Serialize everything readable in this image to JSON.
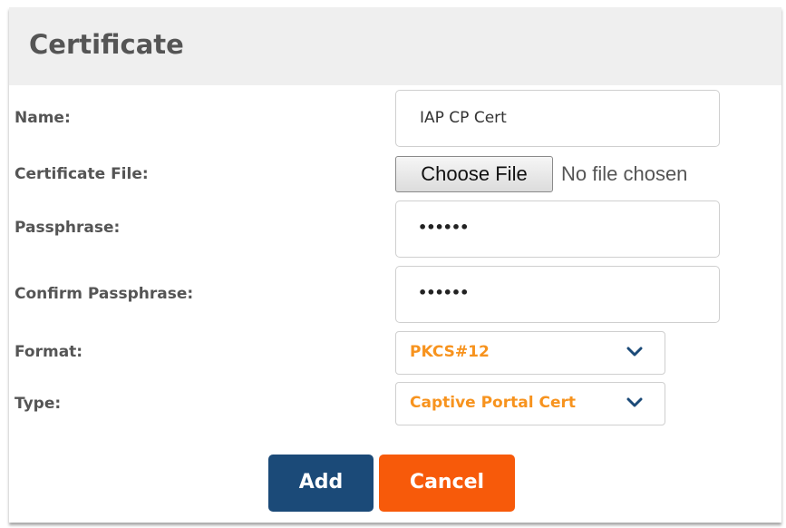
{
  "dialog": {
    "title": "Certificate"
  },
  "form": {
    "name_label": "Name:",
    "name_value": "IAP CP Cert",
    "cert_file_label": "Certificate File:",
    "choose_file_label": "Choose File",
    "no_file_text": "No file chosen",
    "passphrase_label": "Passphrase:",
    "passphrase_value": "••••••",
    "confirm_label": "Confirm Passphrase:",
    "confirm_value": "••••••",
    "format_label": "Format:",
    "format_value": "PKCS#12",
    "type_label": "Type:",
    "type_value": "Captive Portal Cert"
  },
  "buttons": {
    "add_label": "Add",
    "cancel_label": "Cancel"
  },
  "colors": {
    "select_text": "#f7931e",
    "add_button": "#1b4a78",
    "cancel_button": "#f75a0a",
    "chevron": "#1b4a78"
  },
  "icons": {
    "select_arrow": "chevron-down-icon"
  }
}
